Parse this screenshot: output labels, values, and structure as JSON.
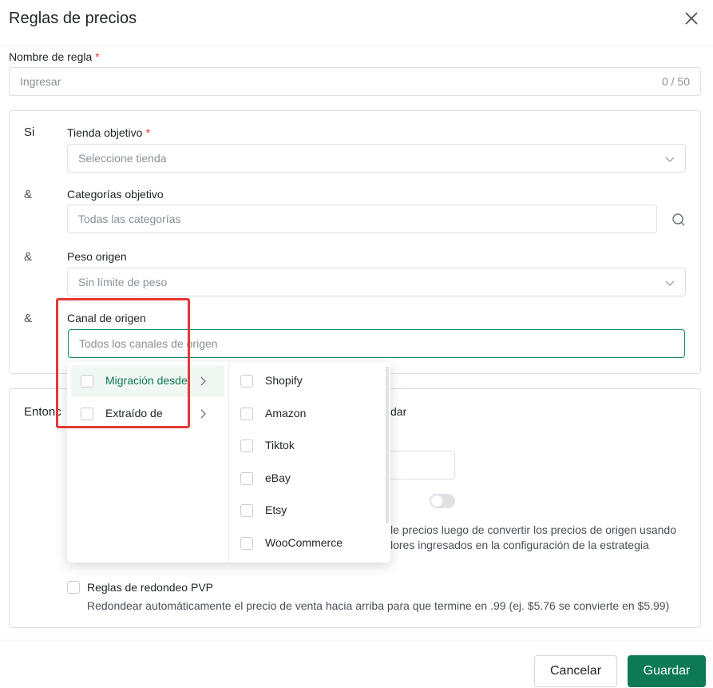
{
  "dialog": {
    "title": "Reglas de precios"
  },
  "rule_name": {
    "label": "Nombre de regla",
    "required_mark": "*",
    "placeholder": "Ingresar",
    "counter": "0 / 50"
  },
  "conditions": {
    "if_label": "Si",
    "and_label": "&",
    "target_store": {
      "label": "Tienda objetivo",
      "required_mark": "*",
      "placeholder": "Seleccione tienda"
    },
    "target_categories": {
      "label": "Categorías objetivo",
      "placeholder": "Todas las categorías"
    },
    "source_weight": {
      "label": "Peso origen",
      "placeholder": "Sin límite de peso"
    },
    "source_channel": {
      "label": "Canal de origen",
      "placeholder": "Todos los canales de origen"
    }
  },
  "dropdown": {
    "left_items": [
      {
        "label": "Migración desde"
      },
      {
        "label": "Extraído de"
      }
    ],
    "right_items": [
      {
        "label": "Shopify"
      },
      {
        "label": "Amazon"
      },
      {
        "label": "Tiktok"
      },
      {
        "label": "eBay"
      },
      {
        "label": "Etsy"
      },
      {
        "label": "WooCommerce"
      }
    ]
  },
  "then_section": {
    "label_partial": "Entonc",
    "text_partial": "dar",
    "desc_line1_partial": "le precios luego de convertir los precios de origen usando",
    "desc_line2_partial": "lores ingresados en la configuración de la estrategia",
    "rounding": {
      "label": "Reglas de redondeo PVP",
      "description": "Redondear automáticamente el precio de venta hacia arriba para que termine en .99 (ej. $5.76 se convierte en $5.99)"
    }
  },
  "footer": {
    "cancel_label": "Cancelar",
    "save_label": "Guardar"
  },
  "colors": {
    "accent": "#0d7a55",
    "highlight_box": "#e53935",
    "required": "#e53935"
  }
}
